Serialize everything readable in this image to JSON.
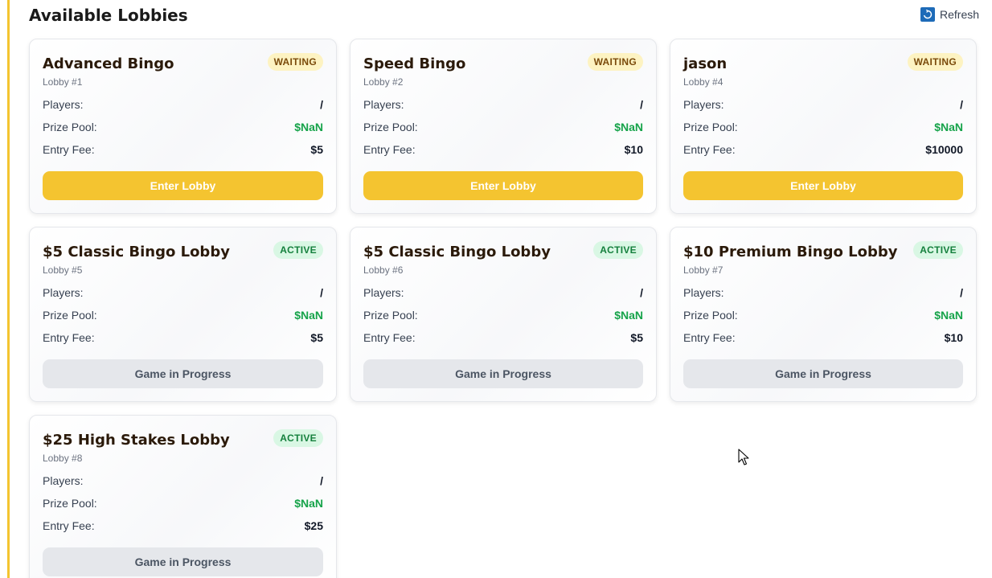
{
  "header": {
    "title": "Available Lobbies",
    "refresh_label": "Refresh"
  },
  "colors": {
    "accent": "#f4c430",
    "prize": "#16a34a",
    "waiting_bg": "#fdf3c2",
    "active_bg": "#d9f7e4",
    "refresh_icon": "#1e6bb8"
  },
  "labels": {
    "players": "Players:",
    "prize_pool": "Prize Pool:",
    "entry_fee": "Entry Fee:"
  },
  "lobbies": [
    {
      "name": "Advanced Bingo",
      "sub": "Lobby #1",
      "status": "WAITING",
      "status_kind": "waiting",
      "players": "/",
      "prize": "$NaN",
      "fee": "$5",
      "action": "Enter Lobby",
      "action_kind": "enter"
    },
    {
      "name": "Speed Bingo",
      "sub": "Lobby #2",
      "status": "WAITING",
      "status_kind": "waiting",
      "players": "/",
      "prize": "$NaN",
      "fee": "$10",
      "action": "Enter Lobby",
      "action_kind": "enter"
    },
    {
      "name": "jason",
      "sub": "Lobby #4",
      "status": "WAITING",
      "status_kind": "waiting",
      "players": "/",
      "prize": "$NaN",
      "fee": "$10000",
      "action": "Enter Lobby",
      "action_kind": "enter"
    },
    {
      "name": "$5 Classic Bingo Lobby",
      "sub": "Lobby #5",
      "status": "ACTIVE",
      "status_kind": "active",
      "players": "/",
      "prize": "$NaN",
      "fee": "$5",
      "action": "Game in Progress",
      "action_kind": "progress"
    },
    {
      "name": "$5 Classic Bingo Lobby",
      "sub": "Lobby #6",
      "status": "ACTIVE",
      "status_kind": "active",
      "players": "/",
      "prize": "$NaN",
      "fee": "$5",
      "action": "Game in Progress",
      "action_kind": "progress"
    },
    {
      "name": "$10 Premium Bingo Lobby",
      "sub": "Lobby #7",
      "status": "ACTIVE",
      "status_kind": "active",
      "players": "/",
      "prize": "$NaN",
      "fee": "$10",
      "action": "Game in Progress",
      "action_kind": "progress"
    },
    {
      "name": "$25 High Stakes Lobby",
      "sub": "Lobby #8",
      "status": "ACTIVE",
      "status_kind": "active",
      "players": "/",
      "prize": "$NaN",
      "fee": "$25",
      "action": "Game in Progress",
      "action_kind": "progress"
    }
  ]
}
